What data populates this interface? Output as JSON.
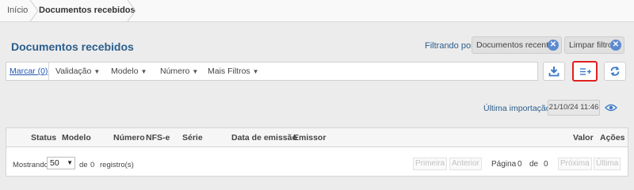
{
  "breadcrumb": {
    "home": "Início",
    "current": "Documentos recebidos"
  },
  "page": {
    "title": "Documentos recebidos"
  },
  "filters": {
    "label": "Filtrando por:",
    "chips": [
      "Documentos recentes"
    ],
    "clear_label": "Limpar filtros"
  },
  "toolbar": {
    "mark_label": "Marcar (0)",
    "items": [
      "Validação",
      "Modelo",
      "Número",
      "Mais Filtros"
    ]
  },
  "import": {
    "label": "Última importação:",
    "value": "21/10/24 11:46"
  },
  "table": {
    "headers": [
      "Status",
      "Modelo",
      "Número",
      "NFS-e",
      "Série",
      "Data de emissão",
      "Emissor",
      "Valor",
      "Ações"
    ]
  },
  "pagination": {
    "showing_label": "Mostrando",
    "page_size": "50",
    "of_label": "de",
    "total": "0",
    "records_label": "registro(s)",
    "first": "Primeira",
    "previous": "Anterior",
    "page_label": "Página",
    "current_page": "0",
    "page_of_label": "de",
    "page_count": "0",
    "next": "Próxima",
    "last": "Última"
  },
  "colors": {
    "title": "#2a5e8c",
    "accent": "#5b8ad0",
    "highlight": "#e02020"
  },
  "icons": [
    "download-icon",
    "add-column-icon",
    "refresh-icon",
    "eye-icon",
    "close-icon",
    "chevron-down-icon"
  ]
}
